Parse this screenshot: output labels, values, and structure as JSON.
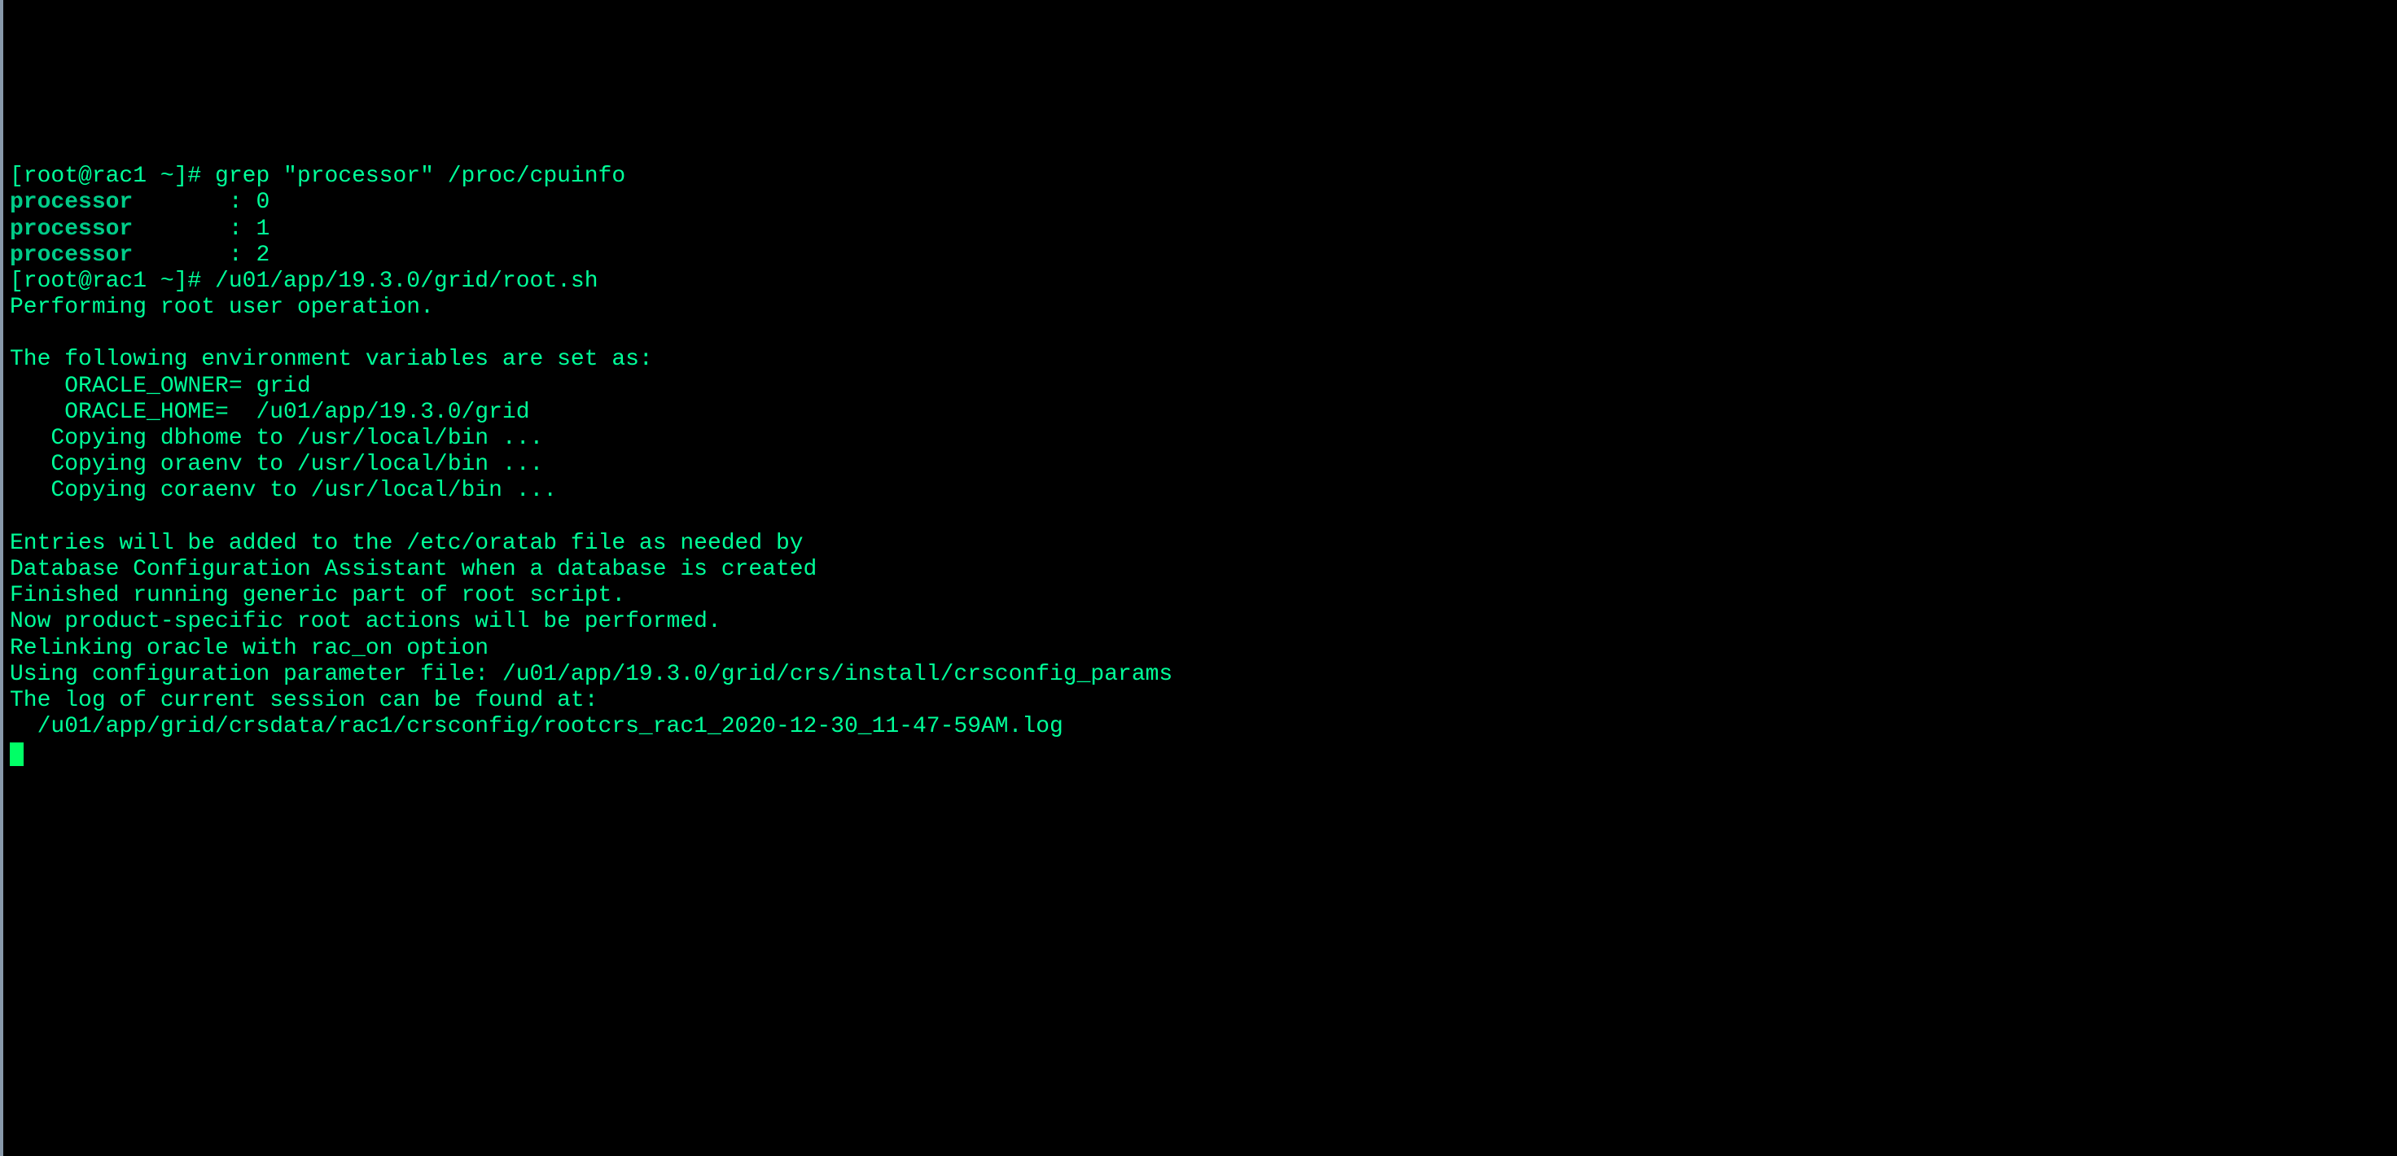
{
  "lines": [
    {
      "segments": [
        {
          "text": "[root@rac1 ~]# ",
          "cls": "prompt"
        },
        {
          "text": "grep \"processor\" /proc/cpuinfo",
          "cls": ""
        }
      ]
    },
    {
      "segments": [
        {
          "text": "processor",
          "cls": "bold"
        },
        {
          "text": "       : 0",
          "cls": ""
        }
      ]
    },
    {
      "segments": [
        {
          "text": "processor",
          "cls": "bold"
        },
        {
          "text": "       : 1",
          "cls": ""
        }
      ]
    },
    {
      "segments": [
        {
          "text": "processor",
          "cls": "bold"
        },
        {
          "text": "       : 2",
          "cls": ""
        }
      ]
    },
    {
      "segments": [
        {
          "text": "[root@rac1 ~]# ",
          "cls": "prompt"
        },
        {
          "text": "/u01/app/19.3.0/grid/root.sh",
          "cls": ""
        }
      ]
    },
    {
      "segments": [
        {
          "text": "Performing root user operation.",
          "cls": ""
        }
      ]
    },
    {
      "segments": [
        {
          "text": "",
          "cls": ""
        }
      ]
    },
    {
      "segments": [
        {
          "text": "The following environment variables are set as:",
          "cls": ""
        }
      ]
    },
    {
      "segments": [
        {
          "text": "    ORACLE_OWNER= grid",
          "cls": ""
        }
      ]
    },
    {
      "segments": [
        {
          "text": "    ORACLE_HOME=  /u01/app/19.3.0/grid",
          "cls": ""
        }
      ]
    },
    {
      "segments": [
        {
          "text": "   Copying dbhome to /usr/local/bin ...",
          "cls": ""
        }
      ]
    },
    {
      "segments": [
        {
          "text": "   Copying oraenv to /usr/local/bin ...",
          "cls": ""
        }
      ]
    },
    {
      "segments": [
        {
          "text": "   Copying coraenv to /usr/local/bin ...",
          "cls": ""
        }
      ]
    },
    {
      "segments": [
        {
          "text": "",
          "cls": ""
        }
      ]
    },
    {
      "segments": [
        {
          "text": "Entries will be added to the /etc/oratab file as needed by",
          "cls": ""
        }
      ]
    },
    {
      "segments": [
        {
          "text": "Database Configuration Assistant when a database is created",
          "cls": ""
        }
      ]
    },
    {
      "segments": [
        {
          "text": "Finished running generic part of root script.",
          "cls": ""
        }
      ]
    },
    {
      "segments": [
        {
          "text": "Now product-specific root actions will be performed.",
          "cls": ""
        }
      ]
    },
    {
      "segments": [
        {
          "text": "Relinking oracle with rac_on option",
          "cls": ""
        }
      ]
    },
    {
      "segments": [
        {
          "text": "Using configuration parameter file: /u01/app/19.3.0/grid/crs/install/crsconfig_params",
          "cls": ""
        }
      ]
    },
    {
      "segments": [
        {
          "text": "The log of current session can be found at:",
          "cls": ""
        }
      ]
    },
    {
      "segments": [
        {
          "text": "  /u01/app/grid/crsdata/rac1/crsconfig/rootcrs_rac1_2020-12-30_11-47-59AM.log",
          "cls": ""
        }
      ]
    }
  ]
}
